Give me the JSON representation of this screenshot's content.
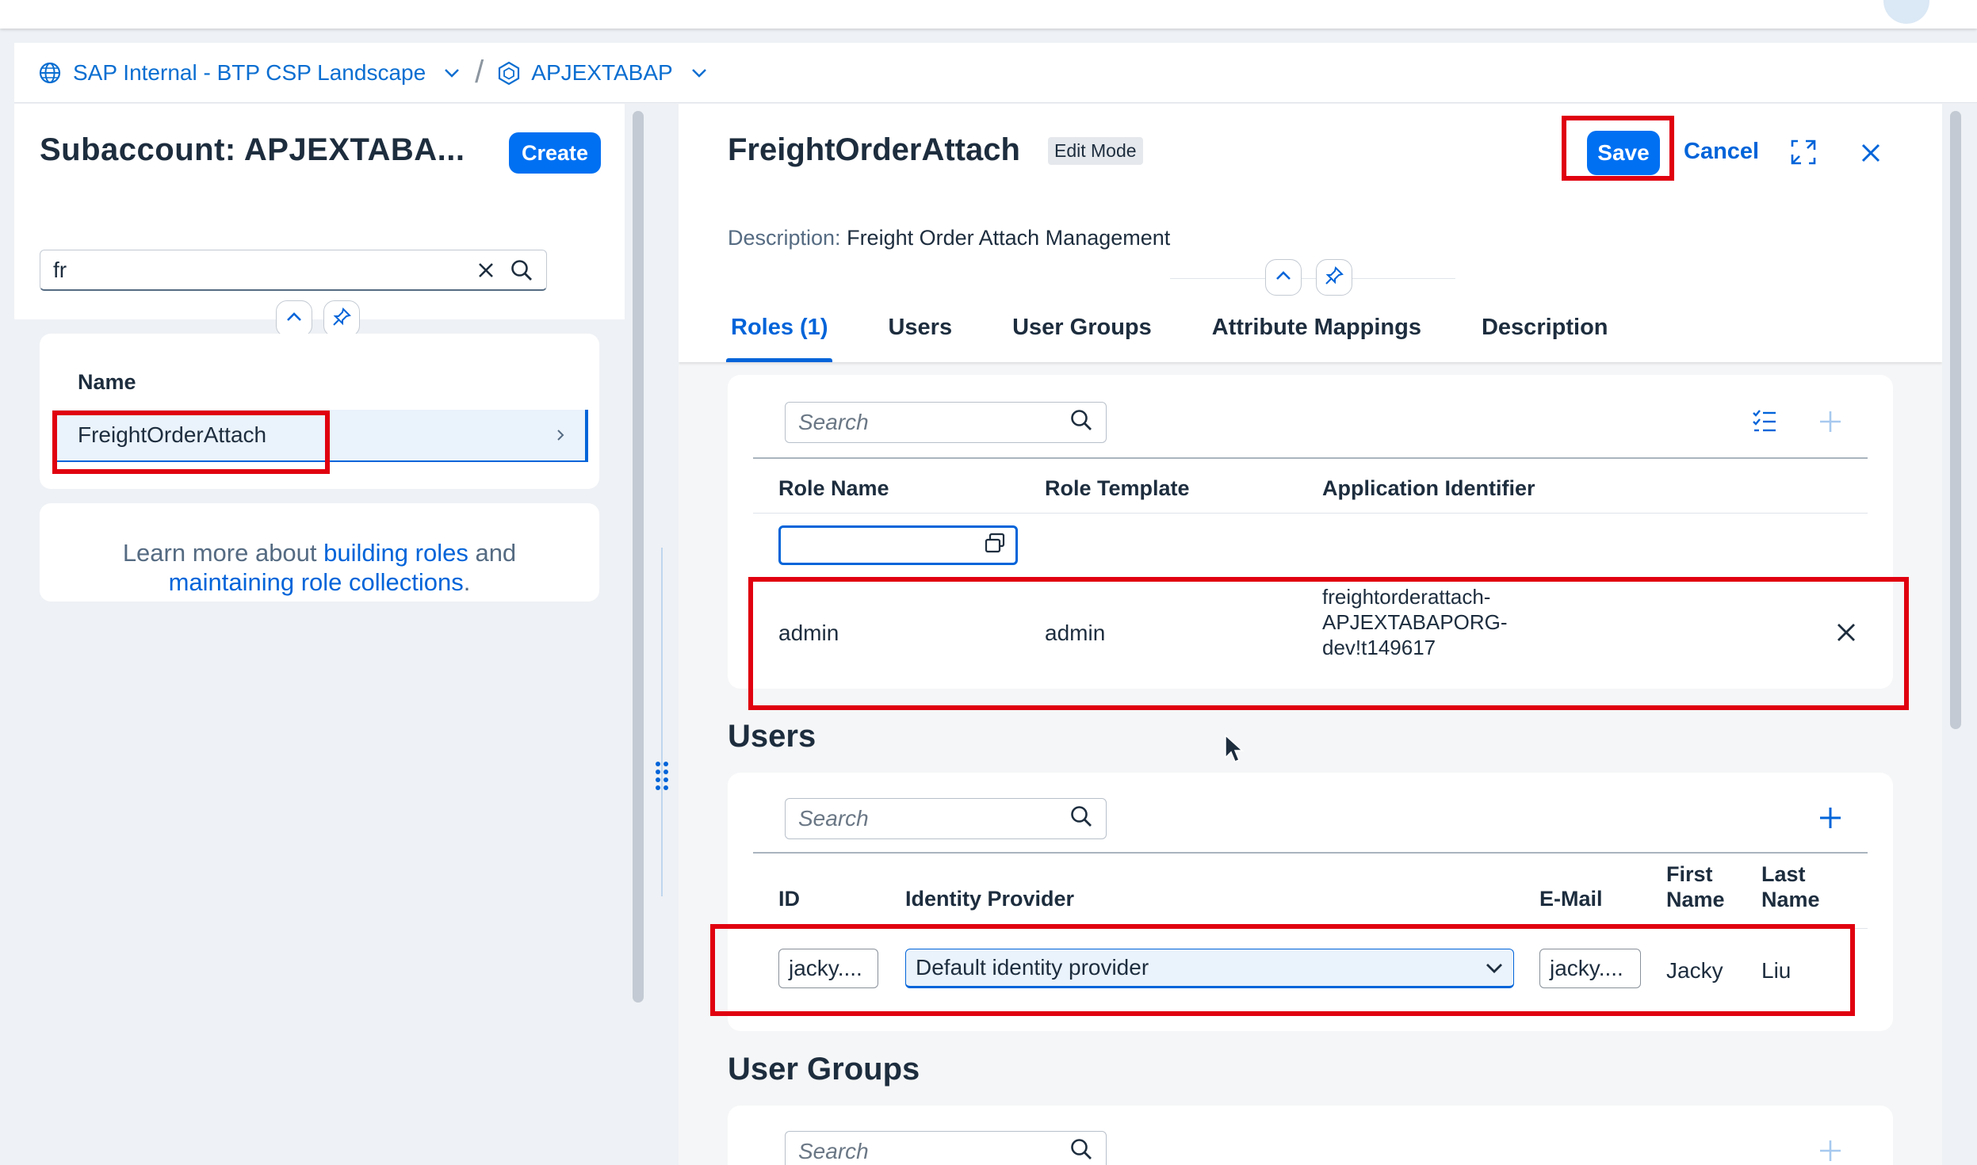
{
  "breadcrumb": {
    "global_account": "SAP Internal - BTP CSP Landscape",
    "subaccount": "APJEXTABAP"
  },
  "left_panel": {
    "title": "Subaccount: APJEXTABA...",
    "create_label": "Create",
    "search_value": "fr",
    "column_header": "Name",
    "list_items": [
      {
        "label": "FreightOrderAttach"
      }
    ],
    "info": {
      "prefix": "Learn more about",
      "link1": "building roles",
      "middle": "and",
      "link2": "maintaining role collections",
      "suffix": "."
    }
  },
  "detail": {
    "title": "FreightOrderAttach",
    "mode_badge": "Edit Mode",
    "save_label": "Save",
    "cancel_label": "Cancel",
    "description_label": "Description:",
    "description_value": "Freight Order Attach Management",
    "tabs": [
      {
        "label": "Roles (1)",
        "active": true
      },
      {
        "label": "Users"
      },
      {
        "label": "User Groups"
      },
      {
        "label": "Attribute Mappings"
      },
      {
        "label": "Description"
      }
    ]
  },
  "roles": {
    "search_placeholder": "Search",
    "columns": [
      "Role Name",
      "Role Template",
      "Application Identifier"
    ],
    "rows": [
      {
        "role_name": "admin",
        "role_template": "admin",
        "app_id_lines": [
          "freightorderattach-",
          "APJEXTABAPORG-",
          "dev!t149617"
        ]
      }
    ]
  },
  "users": {
    "section_title": "Users",
    "search_placeholder": "Search",
    "columns": {
      "id": "ID",
      "idp": "Identity Provider",
      "email": "E-Mail",
      "first_1": "First",
      "first_2": "Name",
      "last_1": "Last",
      "last_2": "Name"
    },
    "rows": [
      {
        "id": "jacky....",
        "idp": "Default identity provider",
        "email": "jacky....",
        "first": "Jacky",
        "last": "Liu"
      }
    ]
  },
  "user_groups": {
    "section_title": "User Groups",
    "search_placeholder": "Search"
  },
  "colors": {
    "accent": "#0070f2",
    "link": "#0064d9",
    "highlight": "#e0000f"
  }
}
